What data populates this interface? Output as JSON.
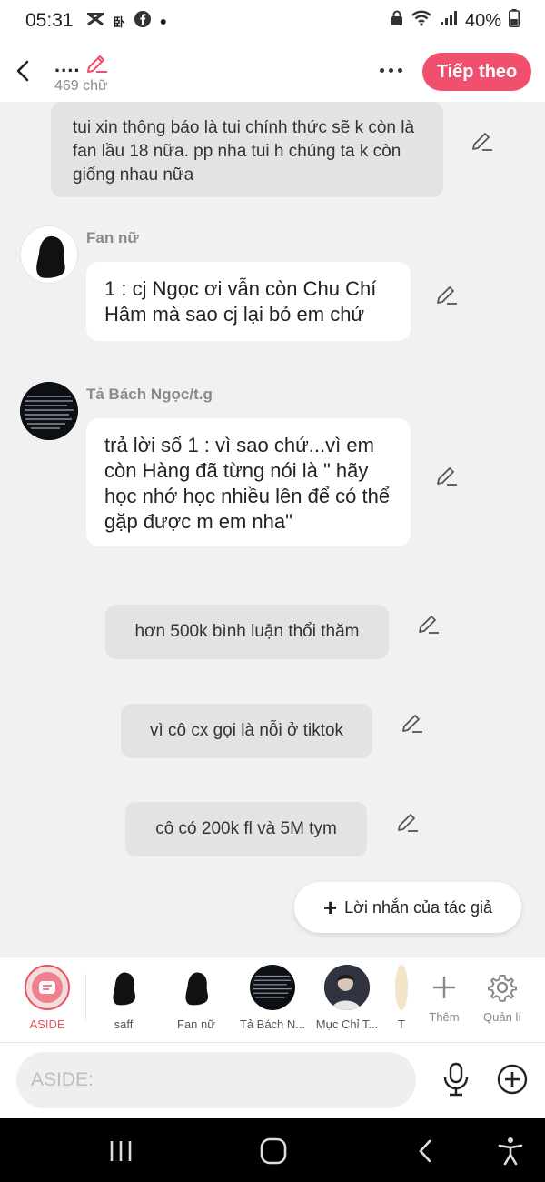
{
  "status_bar": {
    "time": "05:31",
    "battery": "40%"
  },
  "header": {
    "title": "....",
    "word_count": "469 chữ",
    "next_button": "Tiếp theo"
  },
  "messages": {
    "m1": "tui xin thông báo là tui chính thức sẽ k còn là fan lầu 18 nữa. pp nha tui h chúng ta k còn giống nhau nữa",
    "m2_sender": "Fan nữ",
    "m2": "1 : cj Ngọc ơi vẫn còn Chu Chí Hâm mà sao cj lại bỏ em chứ",
    "m3_sender": "Tả Bách Ngọc/t.g",
    "m3": "trả lời số 1 : vì sao chứ...vì em còn Hàng đã từng nói là \" hãy học nhớ học nhiều lên để có thể gặp được m em nha\"",
    "m4": "hơn 500k bình luận thổi thăm",
    "m5": "vì cô cx gọi là nỗi ở tiktok",
    "m6": "cô có 200k fl và 5M tym"
  },
  "author_note_button": "Lời nhắn của tác giả",
  "characters": [
    {
      "label": "ASIDE"
    },
    {
      "label": "saff"
    },
    {
      "label": "Fan nữ"
    },
    {
      "label": "Tả Bách N..."
    },
    {
      "label": "Mục Chỉ T..."
    },
    {
      "label": "T"
    }
  ],
  "tools": {
    "add_label": "Thêm",
    "manage_label": "Quản lí"
  },
  "input": {
    "placeholder": "ASIDE:"
  },
  "colors": {
    "accent": "#f0506e",
    "aside_red": "#e9555f",
    "bubble_grey": "#e3e3e3",
    "background": "#f1f1f1"
  }
}
